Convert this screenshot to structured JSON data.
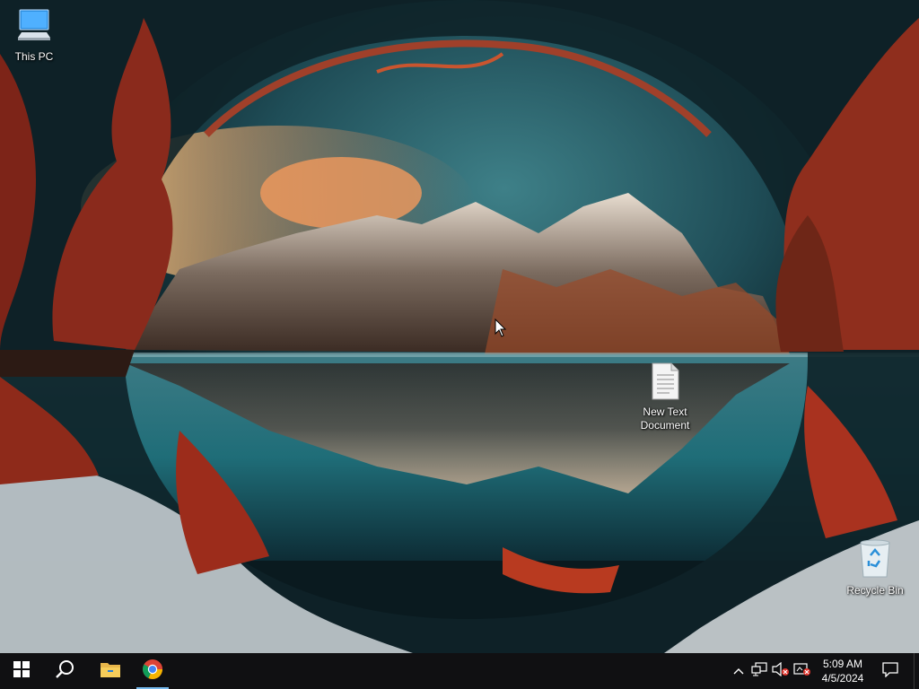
{
  "desktop": {
    "icons": [
      {
        "label": "This PC",
        "icon": "computer-icon"
      },
      {
        "label": "New Text\nDocument",
        "icon": "text-document-icon"
      },
      {
        "label": "Recycle Bin",
        "icon": "recycle-bin-icon"
      }
    ]
  },
  "taskbar": {
    "start": {
      "icon": "windows-logo-icon"
    },
    "search": {
      "icon": "search-icon"
    },
    "pinned": [
      {
        "icon": "file-explorer-icon"
      },
      {
        "icon": "chrome-icon",
        "active": true
      }
    ],
    "tray": {
      "icons": [
        "chevron-up-icon",
        "network-icon",
        "volume-muted-icon",
        "app-tray-icon"
      ],
      "time": "5:09 AM",
      "date": "4/5/2024",
      "notification_icon": "action-center-icon"
    }
  },
  "colors": {
    "taskbar": "#101012",
    "active_indicator": "#76b9ed",
    "sky": "#2f6f78",
    "foliage": "#b8321f"
  }
}
